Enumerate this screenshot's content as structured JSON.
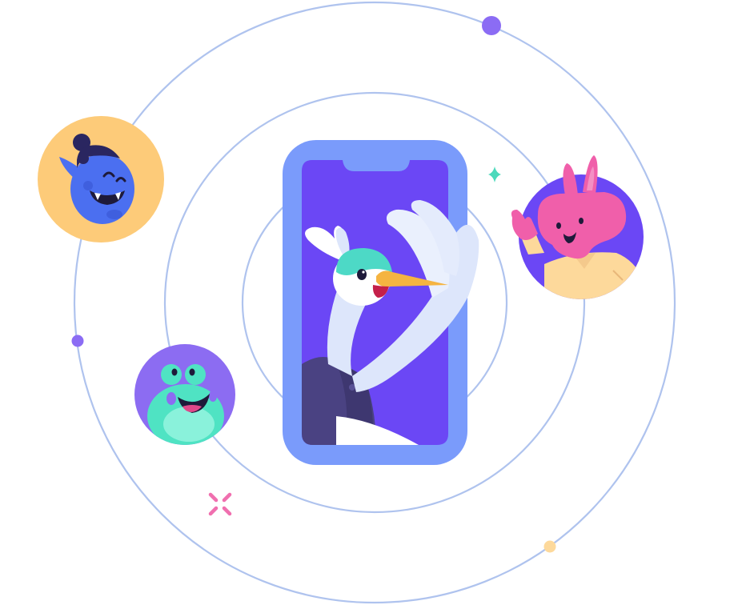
{
  "colors": {
    "orbit_ring": "#AFC3EE",
    "orbit_dot_purple": "#8B6CF4",
    "orbit_dot_yellow": "#FDD99B",
    "phone_frame": "#7A9BFB",
    "phone_screen": "#6B47F5",
    "bird_body": "#DDE6FB",
    "bird_head": "#4DD9C6",
    "bird_beak": "#F5B441",
    "bird_suit": "#4A4282",
    "avatar_orange_bg": "#FDCB79",
    "ogre_skin": "#4B6FF0",
    "avatar_purple_bg": "#8C6CF2",
    "frog_skin": "#4FE3C3",
    "avatar_violet_bg": "#6B47F5",
    "bunny_skin": "#F05FAA",
    "sparkle_teal": "#4CD9BC",
    "sparkle_pink": "#F06FAF"
  },
  "icons": {
    "phone": "smartphone-icon",
    "bird": "hummingbird-character",
    "ogre": "blue-ogre-avatar",
    "frog": "green-frog-avatar",
    "bunny": "pink-bunny-avatar",
    "sparkle": "four-point-sparkle-icon",
    "cross": "cross-sparkle-icon"
  }
}
